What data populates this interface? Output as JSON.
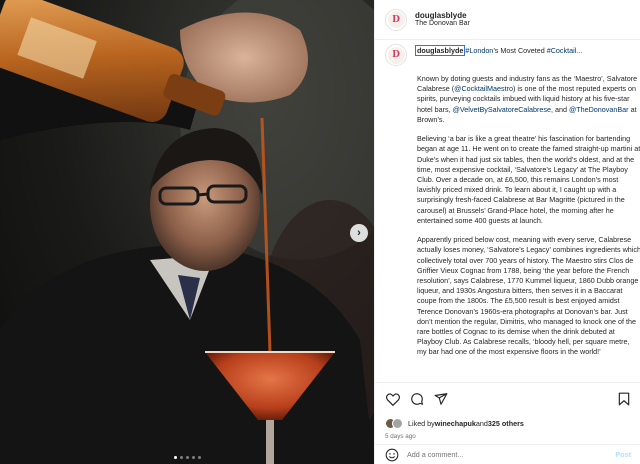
{
  "post": {
    "username": "douglasblyde",
    "location": "The Donovan Bar",
    "avatar_letter": "D"
  },
  "media": {
    "carousel_next": "›",
    "dots": 5,
    "active_dot": 0
  },
  "caption": {
    "username": "douglasblyde",
    "hashtag": "#London",
    "lead": "’s Most Coveted ",
    "hashtag2": "#Cocktail...",
    "paragraphs": [
      [
        {
          "t": "Known by doting guests and industry fans as the ‘Maestro’, Salvatore Calabrese ("
        },
        {
          "t": "@CocktailMaestro",
          "link": true
        },
        {
          "t": ") is one of the most reputed experts on spirits, purveying cocktails imbued with liquid history at his five-star hotel bars, "
        },
        {
          "t": "@VelvetBySalvatoreCalabrese",
          "link": true
        },
        {
          "t": ", and "
        },
        {
          "t": "@TheDonovanBar",
          "link": true
        },
        {
          "t": " at Brown’s."
        }
      ],
      [
        {
          "t": "Believing ‘a bar is like a great theatre’ his fascination for bartending began at age 11. He went on to create the famed straight-up martini at Duke’s when it had just six tables, then the world’s oldest, and at the time, most expensive cocktail, ‘Salvatore’s Legacy’ at The Playboy Club. Over a decade on, at £6,500, this remains London’s most lavishly priced mixed drink. To learn about it, I caught up with a surprisingly fresh-faced Calabrese at Bar Magritte (pictured in the carousel) at Brussels’ Grand-Place hotel, the morning after he entertained some 400 guests at launch."
        }
      ],
      [
        {
          "t": "Apparently priced below cost, meaning with every serve, Calabrese actually loses money, ‘Salvatore’s Legacy’ combines ingredients which collectively total over 700 years of history. The Maestro stirs Clos de Griffier Vieux Cognac from 1788, being ‘the year before the French resolution’, says Calabrese, 1770 Kummel liqueur, 1860 Dubb orange liqueur, and 1930s Angostura bitters, then serves it in a Baccarat coupe from the 1800s. The £5,500 result is best enjoyed amidst Terence Donovan’s 1960s-era photographs at Donovan’s bar. Just don’t mention the regular, Dimitris, who managed to knock one of the rare bottles of Cognac to its demise when the drink debuted at Playboy Club. As Calabrese recalls, ‘bloody hell, per square metre, my bar had one of the most expensive floors in the world!’"
        }
      ]
    ]
  },
  "actions": {
    "icons": [
      "heart-icon",
      "comment-icon",
      "share-icon",
      "bookmark-icon"
    ],
    "liked_by_prefix": "Liked by ",
    "liked_by_user": "winechapuk",
    "liked_by_conj": " and ",
    "liked_by_count": "325 others",
    "time": "5 days ago"
  },
  "comment_box": {
    "placeholder": "Add a comment...",
    "post_label": "Post"
  },
  "colors": {
    "link": "#00376b",
    "brand": "#d43a6a",
    "post_disabled": "#b2dffc"
  }
}
